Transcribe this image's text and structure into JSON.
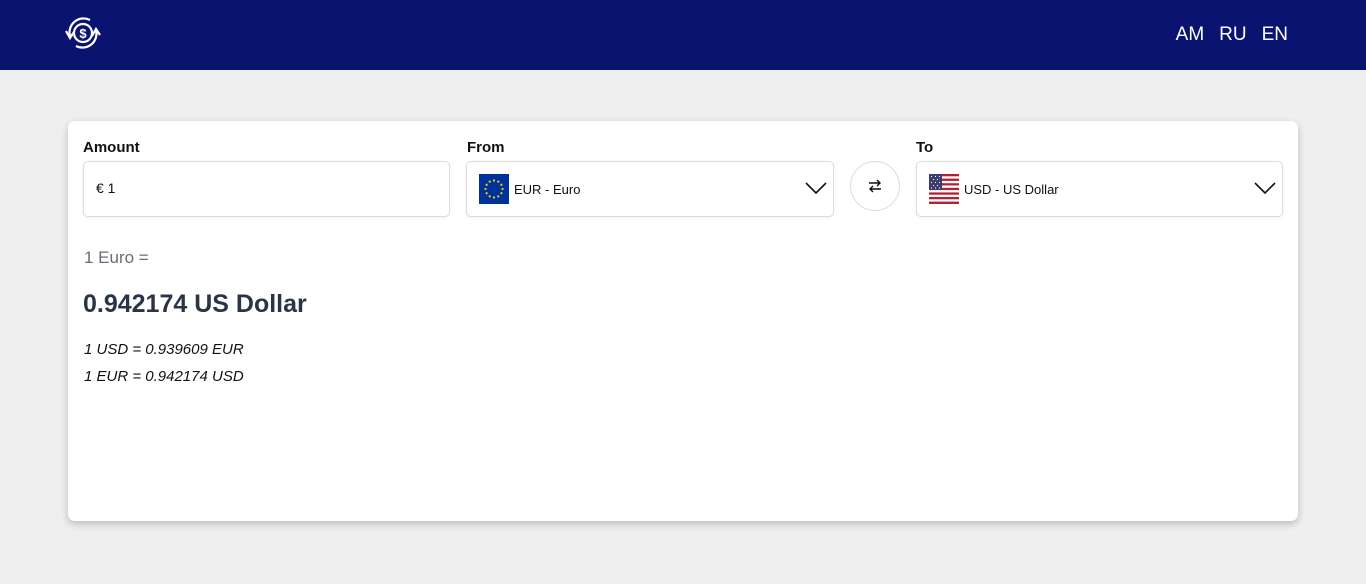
{
  "header": {
    "logo_icon": "currency-exchange-icon",
    "languages": [
      "AM",
      "RU",
      "EN"
    ],
    "background": "#0a1370"
  },
  "converter": {
    "amount": {
      "label": "Amount",
      "value": "€ 1"
    },
    "from": {
      "label": "From",
      "selected": "EUR - Euro",
      "flag_icon": "eu-flag-icon"
    },
    "swap": {
      "icon": "swap-arrows-icon"
    },
    "to": {
      "label": "To",
      "selected": "USD - US Dollar",
      "flag_icon": "us-flag-icon"
    }
  },
  "result": {
    "prefix": "1 Euro =",
    "value": "0.942174 US Dollar",
    "line1": "1 USD = 0.939609 EUR",
    "line2": "1 EUR = 0.942174 USD"
  },
  "colors": {
    "header": "#0a1370",
    "page_bg": "#efefef",
    "result_text": "#2b3447",
    "muted_text": "#6b6b78"
  }
}
